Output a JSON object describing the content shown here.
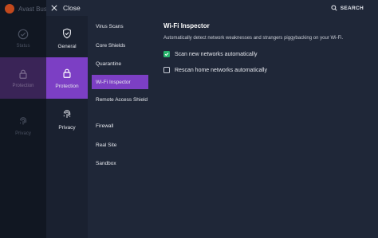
{
  "background_app": {
    "title": "Avast Busin",
    "items": [
      {
        "label": "Status",
        "icon": "check-circle-icon"
      },
      {
        "label": "Protection",
        "icon": "lock-icon"
      },
      {
        "label": "Privacy",
        "icon": "fingerprint-icon"
      }
    ]
  },
  "topbar": {
    "close_label": "Close",
    "search_label": "SEARCH"
  },
  "categories": [
    {
      "label": "General",
      "icon": "shield-check-icon",
      "active": false
    },
    {
      "label": "Protection",
      "icon": "lock-icon",
      "active": true
    },
    {
      "label": "Privacy",
      "icon": "fingerprint-icon",
      "active": false
    }
  ],
  "submenu": [
    {
      "label": "Virus Scans",
      "active": false
    },
    {
      "label": "Core Shields",
      "active": false
    },
    {
      "label": "Quarantine",
      "active": false
    },
    {
      "label": "Wi-Fi Inspector",
      "active": true
    },
    {
      "label": "Remote Access Shield",
      "active": false
    },
    {
      "label": "Firewall",
      "active": false
    },
    {
      "label": "Real Site",
      "active": false
    },
    {
      "label": "Sandbox",
      "active": false
    }
  ],
  "content": {
    "title": "Wi-Fi Inspector",
    "description": "Automatically detect network weaknesses and strangers piggybacking on your Wi-Fi.",
    "options": [
      {
        "label": "Scan new networks automatically",
        "checked": true
      },
      {
        "label": "Rescan home networks automatically",
        "checked": false
      }
    ]
  },
  "colors": {
    "accent": "#7c3fc4",
    "checkbox_checked": "#26b36b",
    "background": "#1f2738"
  }
}
